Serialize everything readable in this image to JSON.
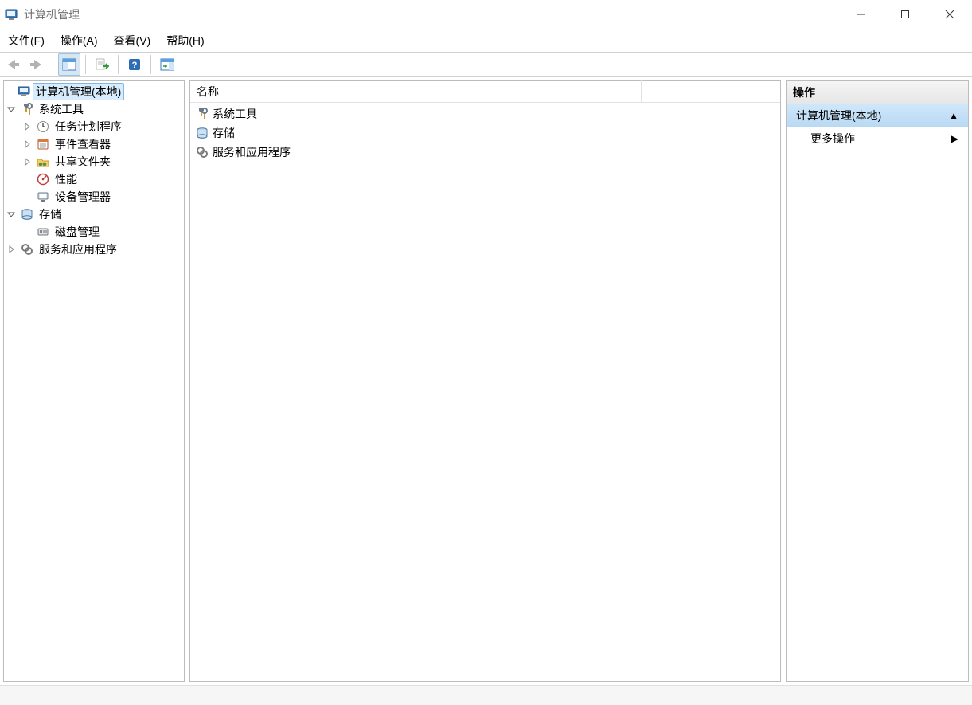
{
  "titlebar": {
    "title": "计算机管理"
  },
  "menu": {
    "file": "文件(F)",
    "action": "操作(A)",
    "view": "查看(V)",
    "help": "帮助(H)"
  },
  "tree": {
    "root": "计算机管理(本地)",
    "system_tools": "系统工具",
    "task_scheduler": "任务计划程序",
    "event_viewer": "事件查看器",
    "shared_folders": "共享文件夹",
    "performance": "性能",
    "device_manager": "设备管理器",
    "storage": "存储",
    "disk_management": "磁盘管理",
    "services_apps": "服务和应用程序"
  },
  "list": {
    "header_name": "名称",
    "items": {
      "0": "系统工具",
      "1": "存储",
      "2": "服务和应用程序"
    }
  },
  "actions": {
    "header": "操作",
    "group": "计算机管理(本地)",
    "more": "更多操作"
  }
}
